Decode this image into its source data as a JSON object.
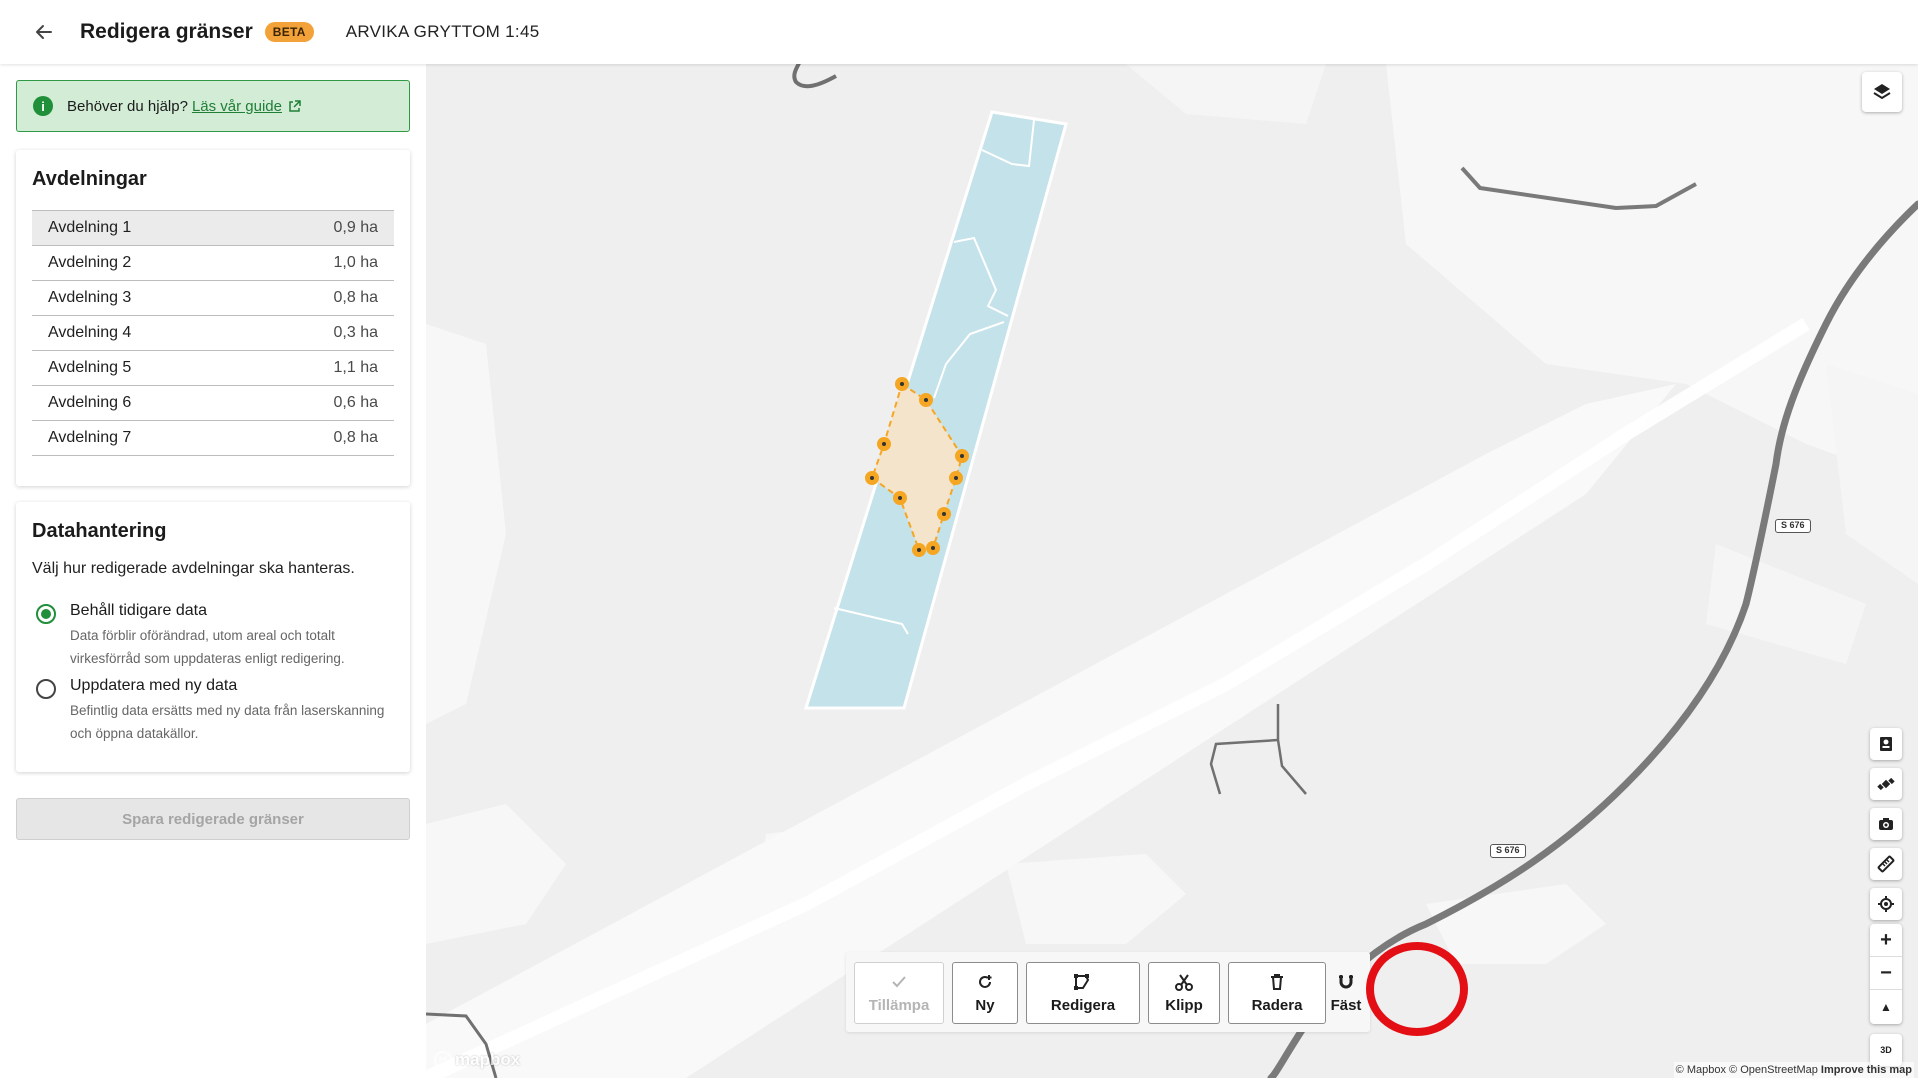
{
  "header": {
    "back_icon": "arrow-left-icon",
    "title": "Redigera gränser",
    "badge": "BETA",
    "property_name": "ARVIKA GRYTTOM 1:45"
  },
  "help": {
    "icon": "info-icon",
    "text": "Behöver du hjälp?",
    "link_label": "Läs vår guide",
    "link_icon": "external-link-icon"
  },
  "sections": {
    "title": "Avdelningar",
    "items": [
      {
        "name": "Avdelning 1",
        "area": "0,9 ha",
        "selected": true
      },
      {
        "name": "Avdelning 2",
        "area": "1,0 ha"
      },
      {
        "name": "Avdelning 3",
        "area": "0,8 ha"
      },
      {
        "name": "Avdelning 4",
        "area": "0,3 ha"
      },
      {
        "name": "Avdelning 5",
        "area": "1,1 ha"
      },
      {
        "name": "Avdelning 6",
        "area": "0,6 ha"
      },
      {
        "name": "Avdelning 7",
        "area": "0,8 ha"
      }
    ]
  },
  "data_handling": {
    "title": "Datahantering",
    "description": "Välj hur redigerade avdelningar ska hanteras.",
    "options": [
      {
        "label": "Behåll tidigare data",
        "sub": "Data förblir oförändrad, utom areal och totalt virkesförråd som uppdateras enligt redigering.",
        "checked": true
      },
      {
        "label": "Uppdatera med ny data",
        "sub": "Befintlig data ersätts med ny data från laserskanning och öppna datakällor.",
        "checked": false
      }
    ]
  },
  "save_button": "Spara redigerade gränser",
  "toolbar": {
    "apply": "Tillämpa",
    "new": "Ny",
    "edit": "Redigera",
    "cut": "Klipp",
    "delete": "Radera",
    "snap": "Fäst"
  },
  "map": {
    "road_label": "S 676",
    "attribution_mapbox": "© Mapbox",
    "attribution_osm": "© OpenStreetMap",
    "attribution_improve": "Improve this map",
    "logo": "mapbox",
    "colors": {
      "forest_fill": "#c4e2ea",
      "edit_fill": "#f5e4cc",
      "vertex": "#f5a623",
      "highlight": "#e40f14",
      "accent_green": "#1f8f3a"
    },
    "right_controls": [
      "contact-icon",
      "satellite-icon",
      "camera-icon",
      "ruler-icon",
      "locate-icon"
    ],
    "zoom": {
      "in": "+",
      "out": "−",
      "compass": "▲"
    },
    "view_3d": "3D"
  }
}
